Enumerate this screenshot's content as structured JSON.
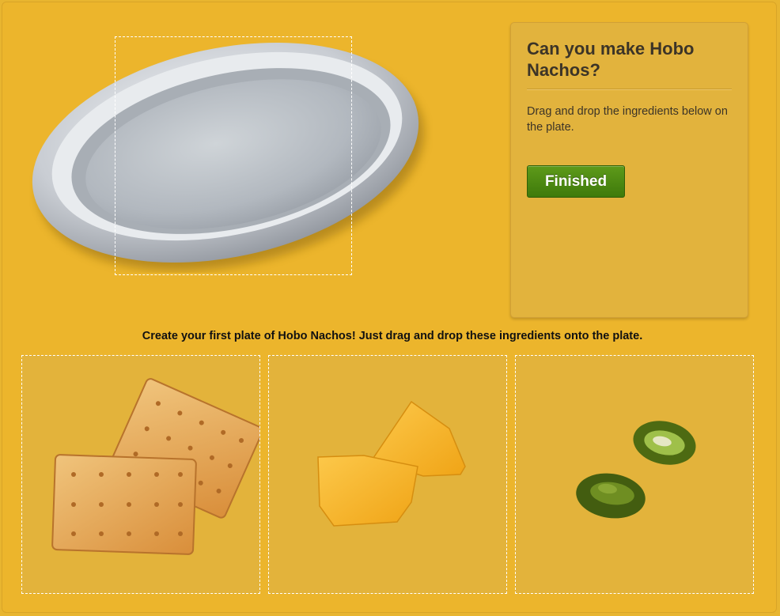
{
  "panel": {
    "title": "Can you make Hobo Nachos?",
    "description": "Drag and drop the ingredients below on the plate.",
    "finished_label": "Finished"
  },
  "instructions": "Create your first plate of Hobo Nachos! Just drag and drop these ingredients onto the plate.",
  "ingredients": [
    {
      "name": "crackers",
      "icon": "crackers-icon"
    },
    {
      "name": "cheese",
      "icon": "cheese-slices-icon"
    },
    {
      "name": "jalapenos",
      "icon": "jalapeno-slices-icon"
    }
  ],
  "colors": {
    "background": "#ecb52c",
    "panel": "#e2b33d",
    "button": "#4c8a12",
    "title_text": "#3c3427"
  }
}
